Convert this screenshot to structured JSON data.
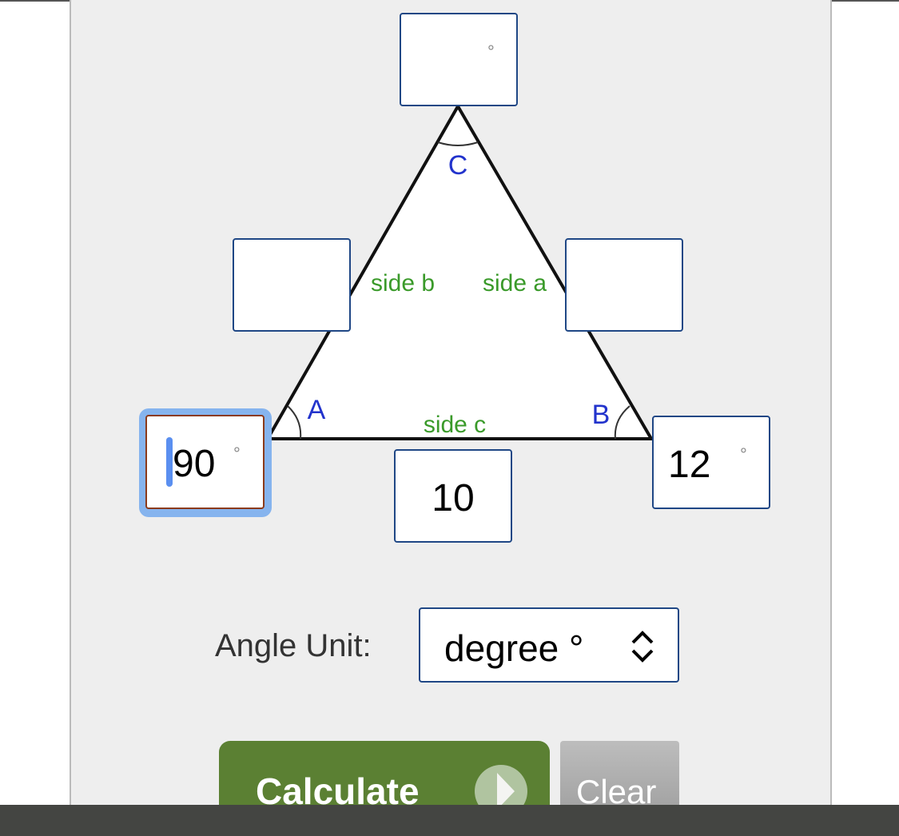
{
  "triangle": {
    "label_a": "A",
    "label_b": "B",
    "label_c": "C",
    "side_a": "side a",
    "side_b": "side b",
    "side_c": "side c"
  },
  "inputs": {
    "angle_c": "",
    "side_b": "",
    "side_a": "",
    "angle_a": "90",
    "side_c": "10",
    "angle_b": "12",
    "degree_symbol": "°"
  },
  "angle_unit": {
    "label": "Angle Unit:",
    "selected": "degree °"
  },
  "buttons": {
    "calculate": "Calculate",
    "clear": "Clear"
  },
  "colors": {
    "input_border": "#1f4785",
    "focus_border": "#8b3a1a",
    "calculate_bg": "#5b8033",
    "vertex_label": "#2233cc",
    "side_label": "#3a9a2a"
  }
}
